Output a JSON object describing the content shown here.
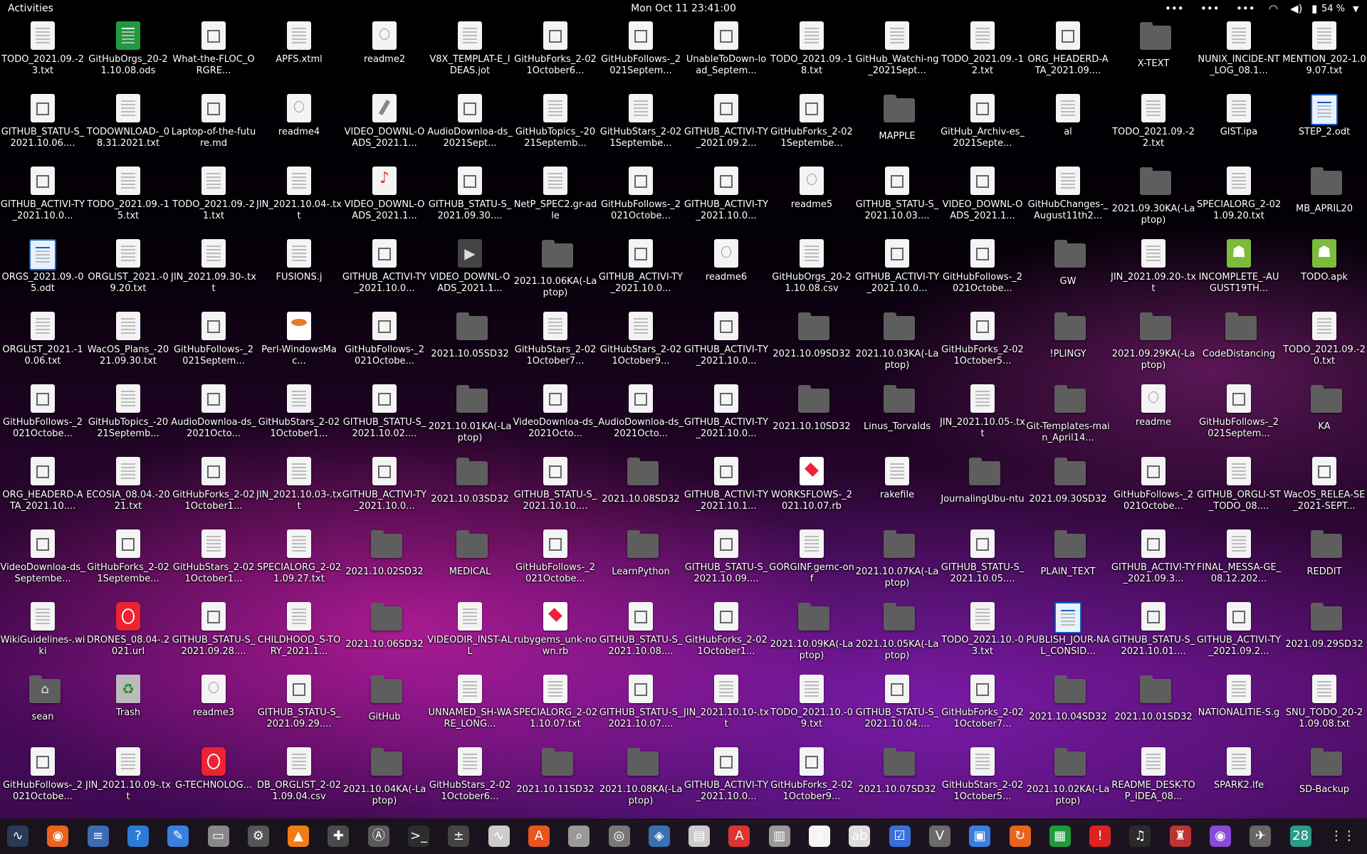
{
  "topbar": {
    "activities": "Activities",
    "clock": "Mon Oct 11  23:41:00",
    "battery": "54 %"
  },
  "desktop": {
    "icons": [
      {
        "label": "TODO_2021.09.-23.txt",
        "type": "doc"
      },
      {
        "label": "GitHubOrgs_20-21.10.08.ods",
        "type": "green"
      },
      {
        "label": "What-the-FLOC_ORGRE...",
        "type": "md"
      },
      {
        "label": "APFS.xtml",
        "type": "doc"
      },
      {
        "label": "readme2",
        "type": "info"
      },
      {
        "label": "V8X_TEMPLAT-E_IDEAS.jot",
        "type": "doc"
      },
      {
        "label": "GitHubForks_2-021October6...",
        "type": "md"
      },
      {
        "label": "GitHubFollows-_2021Septem...",
        "type": "md"
      },
      {
        "label": "UnableToDown-load_Septem...",
        "type": "md"
      },
      {
        "label": "TODO_2021.09.-18.txt",
        "type": "doc"
      },
      {
        "label": "GitHub_Watchi-ng_2021Sept...",
        "type": "doc"
      },
      {
        "label": "TODO_2021.09.-12.txt",
        "type": "doc"
      },
      {
        "label": "ORG_HEADERD-ATA_2021.09....",
        "type": "md"
      },
      {
        "label": "X-TEXT",
        "type": "folder"
      },
      {
        "label": "NUNIX_INCIDE-NT_LOG_08.1...",
        "type": "doc"
      },
      {
        "label": "MENTION_202-1.09.07.txt",
        "type": "doc"
      },
      {
        "label": "GITHUB_STATU-S_2021.10.06....",
        "type": "md"
      },
      {
        "label": "TODOWNLOAD-_08.31.2021.txt",
        "type": "doc"
      },
      {
        "label": "Laptop-of-the-future.md",
        "type": "md"
      },
      {
        "label": "readme4",
        "type": "info"
      },
      {
        "label": "VIDEO_DOWNL-OADS_2021.1...",
        "type": "hammer"
      },
      {
        "label": "AudioDownloa-ds_2021Sept...",
        "type": "md"
      },
      {
        "label": "GitHubTopics_-2021Septemb...",
        "type": "doc"
      },
      {
        "label": "GitHubStars_2-021Septembe...",
        "type": "doc"
      },
      {
        "label": "GITHUB_ACTIVI-TY_2021.09.2...",
        "type": "md"
      },
      {
        "label": "GitHubForks_2-021Septembe...",
        "type": "md"
      },
      {
        "label": "MAPPLE",
        "type": "folder"
      },
      {
        "label": "GitHub_Archiv-es_2021Septe...",
        "type": "md"
      },
      {
        "label": "al",
        "type": "doc"
      },
      {
        "label": "TODO_2021.09.-22.txt",
        "type": "doc"
      },
      {
        "label": "GIST.ipa",
        "type": "doc"
      },
      {
        "label": "STEP_2.odt",
        "type": "blue"
      },
      {
        "label": "GITHUB_ACTIVI-TY_2021.10.0...",
        "type": "md"
      },
      {
        "label": "TODO_2021.09.-15.txt",
        "type": "doc"
      },
      {
        "label": "TODO_2021.09.-21.txt",
        "type": "doc"
      },
      {
        "label": "JIN_2021.10.04-.txt",
        "type": "doc"
      },
      {
        "label": "VIDEO_DOWNL-OADS_2021.1...",
        "type": "mp3"
      },
      {
        "label": "GITHUB_STATU-S_2021.09.30....",
        "type": "md"
      },
      {
        "label": "NetP_SPEC2.gr-adle",
        "type": "doc"
      },
      {
        "label": "GitHubFollows-_2021Octobe...",
        "type": "md"
      },
      {
        "label": "GITHUB_ACTIVI-TY_2021.10.0...",
        "type": "md"
      },
      {
        "label": "readme5",
        "type": "info"
      },
      {
        "label": "GITHUB_STATU-S_2021.10.03....",
        "type": "md"
      },
      {
        "label": "VIDEO_DOWNL-OADS_2021.1...",
        "type": "md"
      },
      {
        "label": "GitHubChanges-_August11th2...",
        "type": "doc"
      },
      {
        "label": "2021.09.30KA(-Laptop)",
        "type": "folder"
      },
      {
        "label": "SPECIALORG_2-021.09.20.txt",
        "type": "doc"
      },
      {
        "label": "MB_APRIL20",
        "type": "folder"
      },
      {
        "label": "ORGS_2021.09.-05.odt",
        "type": "blue"
      },
      {
        "label": "ORGLIST_2021.-09.20.txt",
        "type": "doc"
      },
      {
        "label": "JIN_2021.09.30-.txt",
        "type": "doc"
      },
      {
        "label": "FUSIONS.j",
        "type": "doc"
      },
      {
        "label": "GITHUB_ACTIVI-TY_2021.10.0...",
        "type": "md"
      },
      {
        "label": "VIDEO_DOWNL-OADS_2021.1...",
        "type": "video"
      },
      {
        "label": "2021.10.06KA(-Laptop)",
        "type": "folder"
      },
      {
        "label": "GITHUB_ACTIVI-TY_2021.10.0...",
        "type": "md"
      },
      {
        "label": "readme6",
        "type": "info"
      },
      {
        "label": "GitHubOrgs_20-21.10.08.csv",
        "type": "doc"
      },
      {
        "label": "GITHUB_ACTIVI-TY_2021.10.0...",
        "type": "md"
      },
      {
        "label": "GitHubFollows-_2021Octobe...",
        "type": "md"
      },
      {
        "label": "GW",
        "type": "folder"
      },
      {
        "label": "JIN_2021.09.20-.txt",
        "type": "doc"
      },
      {
        "label": "INCOMPLETE_-AUGUST19TH...",
        "type": "apk"
      },
      {
        "label": "TODO.apk",
        "type": "apk"
      },
      {
        "label": "ORGLIST_2021.-10.06.txt",
        "type": "doc"
      },
      {
        "label": "WacOS_Plans_-2021.09.30.txt",
        "type": "doc"
      },
      {
        "label": "GitHubFollows-_2021Septem...",
        "type": "md"
      },
      {
        "label": "Perl-WindowsMac...",
        "type": "yaml"
      },
      {
        "label": "GitHubFollows-_2021Octobe...",
        "type": "md"
      },
      {
        "label": "2021.10.05SD32",
        "type": "folder"
      },
      {
        "label": "GitHubStars_2-021October7...",
        "type": "doc"
      },
      {
        "label": "GitHubStars_2-021October9...",
        "type": "doc"
      },
      {
        "label": "GITHUB_ACTIVI-TY_2021.10.0...",
        "type": "md"
      },
      {
        "label": "2021.10.09SD32",
        "type": "folder"
      },
      {
        "label": "2021.10.03KA(-Laptop)",
        "type": "folder"
      },
      {
        "label": "GitHubForks_2-021October5...",
        "type": "md"
      },
      {
        "label": "!PLINGY",
        "type": "folder"
      },
      {
        "label": "2021.09.29KA(-Laptop)",
        "type": "folder"
      },
      {
        "label": "CodeDistancing",
        "type": "folder"
      },
      {
        "label": "TODO_2021.09.-20.txt",
        "type": "doc"
      },
      {
        "label": "GitHubFollows-_2021Octobe...",
        "type": "md"
      },
      {
        "label": "GitHubTopics_-2021Septemb...",
        "type": "doc"
      },
      {
        "label": "AudioDownloa-ds_2021Octo...",
        "type": "md"
      },
      {
        "label": "GitHubStars_2-021October1...",
        "type": "doc"
      },
      {
        "label": "GITHUB_STATU-S_2021.10.02....",
        "type": "md"
      },
      {
        "label": "2021.10.01KA(-Laptop)",
        "type": "folder"
      },
      {
        "label": "VideoDownloa-ds_2021Octo...",
        "type": "md"
      },
      {
        "label": "AudioDownloa-ds_2021Octo...",
        "type": "md"
      },
      {
        "label": "GITHUB_ACTIVI-TY_2021.10.0...",
        "type": "md"
      },
      {
        "label": "2021.10.10SD32",
        "type": "folder"
      },
      {
        "label": "Linus_Torvalds",
        "type": "folder"
      },
      {
        "label": "JIN_2021.10.05-.txt",
        "type": "doc"
      },
      {
        "label": "Git-Templates-main_April14...",
        "type": "folder"
      },
      {
        "label": "readme",
        "type": "info"
      },
      {
        "label": "GitHubFollows-_2021Septem...",
        "type": "md"
      },
      {
        "label": "KA",
        "type": "folder"
      },
      {
        "label": "ORG_HEADERD-ATA_2021.10....",
        "type": "md"
      },
      {
        "label": "ECOSIA_08.04.-2021.txt",
        "type": "doc"
      },
      {
        "label": "GitHubForks_2-021October1...",
        "type": "md"
      },
      {
        "label": "JIN_2021.10.03-.txt",
        "type": "doc"
      },
      {
        "label": "GITHUB_ACTIVI-TY_2021.10.0...",
        "type": "md"
      },
      {
        "label": "2021.10.03SD32",
        "type": "folder"
      },
      {
        "label": "GITHUB_STATU-S_2021.10.10....",
        "type": "md"
      },
      {
        "label": "2021.10.08SD32",
        "type": "folder"
      },
      {
        "label": "GITHUB_ACTIVI-TY_2021.10.1...",
        "type": "md"
      },
      {
        "label": "WORKSFLOWS-_2021.10.07.rb",
        "type": "red"
      },
      {
        "label": "rakefile",
        "type": "doc"
      },
      {
        "label": "JournalingUbu-ntu",
        "type": "folder"
      },
      {
        "label": "2021.09.30SD32",
        "type": "folder"
      },
      {
        "label": "GitHubFollows-_2021Octobe...",
        "type": "md"
      },
      {
        "label": "GITHUB_ORGLI-ST_TODO_08....",
        "type": "doc"
      },
      {
        "label": "WacOS_RELEA-SE_2021-SEPT...",
        "type": "md"
      },
      {
        "label": "VideoDownloa-ds_Septembe...",
        "type": "md"
      },
      {
        "label": "GitHubForks_2-021Septembe...",
        "type": "md"
      },
      {
        "label": "GitHubStars_2-021October1...",
        "type": "doc"
      },
      {
        "label": "SPECIALORG_2-021.09.27.txt",
        "type": "doc"
      },
      {
        "label": "2021.10.02SD32",
        "type": "folder"
      },
      {
        "label": "MEDICAL",
        "type": "folder"
      },
      {
        "label": "GitHubFollows-_2021Octobe...",
        "type": "md"
      },
      {
        "label": "LearnPython",
        "type": "folder"
      },
      {
        "label": "GITHUB_STATU-S_2021.10.09....",
        "type": "md"
      },
      {
        "label": "GORGINF.gemc-onf",
        "type": "doc"
      },
      {
        "label": "2021.10.07KA(-Laptop)",
        "type": "folder"
      },
      {
        "label": "GITHUB_STATU-S_2021.10.05....",
        "type": "md"
      },
      {
        "label": "PLAIN_TEXT",
        "type": "folder"
      },
      {
        "label": "GITHUB_ACTIVI-TY_2021.09.3...",
        "type": "md"
      },
      {
        "label": "FINAL_MESSA-GE_08.12.202...",
        "type": "doc"
      },
      {
        "label": "REDDIT",
        "type": "folder"
      },
      {
        "label": "WikiGuidelines-.wiki",
        "type": "doc"
      },
      {
        "label": "DRONES_08.04-.2021.url",
        "type": "nosign"
      },
      {
        "label": "GITHUB_STATU-S_2021.09.28....",
        "type": "md"
      },
      {
        "label": "CHILDHOOD_S-TORY_2021.1...",
        "type": "doc"
      },
      {
        "label": "2021.10.06SD32",
        "type": "folder"
      },
      {
        "label": "VIDEODIR_INST-ALL",
        "type": "doc"
      },
      {
        "label": "rubygems_unk-nown.rb",
        "type": "red"
      },
      {
        "label": "GITHUB_STATU-S_2021.10.08....",
        "type": "md"
      },
      {
        "label": "GitHubForks_2-021October1...",
        "type": "md"
      },
      {
        "label": "2021.10.09KA(-Laptop)",
        "type": "folder"
      },
      {
        "label": "2021.10.05KA(-Laptop)",
        "type": "folder"
      },
      {
        "label": "TODO_2021.10.-03.txt",
        "type": "doc"
      },
      {
        "label": "PUBLISH_JOUR-NAL_CONSID...",
        "type": "blue"
      },
      {
        "label": "GITHUB_STATU-S_2021.10.01....",
        "type": "md"
      },
      {
        "label": "GITHUB_ACTIVI-TY_2021.09.2...",
        "type": "md"
      },
      {
        "label": "2021.09.29SD32",
        "type": "folder"
      },
      {
        "label": "sean",
        "type": "home"
      },
      {
        "label": "Trash",
        "type": "trash"
      },
      {
        "label": "readme3",
        "type": "info"
      },
      {
        "label": "GITHUB_STATU-S_2021.09.29....",
        "type": "md"
      },
      {
        "label": "GitHub",
        "type": "folder"
      },
      {
        "label": "UNNAMED_SH-WARE_LONG...",
        "type": "doc"
      },
      {
        "label": "SPECIALORG_2-021.10.07.txt",
        "type": "doc"
      },
      {
        "label": "GITHUB_STATU-S_2021.10.07....",
        "type": "md"
      },
      {
        "label": "JIN_2021.10.10-.txt",
        "type": "doc"
      },
      {
        "label": "TODO_2021.10.-09.txt",
        "type": "doc"
      },
      {
        "label": "GITHUB_STATU-S_2021.10.04....",
        "type": "md"
      },
      {
        "label": "GitHubForks_2-021October7...",
        "type": "md"
      },
      {
        "label": "2021.10.04SD32",
        "type": "folder"
      },
      {
        "label": "2021.10.01SD32",
        "type": "folder"
      },
      {
        "label": "NATIONALITIE-S.g",
        "type": "doc"
      },
      {
        "label": "SNU_TODO_20-21.09.08.txt",
        "type": "doc"
      },
      {
        "label": "GitHubFollows-_2021Octobe...",
        "type": "md"
      },
      {
        "label": "JIN_2021.10.09-.txt",
        "type": "doc"
      },
      {
        "label": "G-TECHNOLOG...",
        "type": "nosign"
      },
      {
        "label": "DB_ORGLIST_2-021.09.04.csv",
        "type": "doc"
      },
      {
        "label": "2021.10.04KA(-Laptop)",
        "type": "folder"
      },
      {
        "label": "GitHubStars_2-021October6...",
        "type": "doc"
      },
      {
        "label": "2021.10.11SD32",
        "type": "folder"
      },
      {
        "label": "2021.10.08KA(-Laptop)",
        "type": "folder"
      },
      {
        "label": "GITHUB_ACTIVI-TY_2021.10.0...",
        "type": "md"
      },
      {
        "label": "GitHubForks_2-021October9...",
        "type": "md"
      },
      {
        "label": "2021.10.07SD32",
        "type": "folder"
      },
      {
        "label": "GitHubStars_2-021October5...",
        "type": "doc"
      },
      {
        "label": "2021.10.02KA(-Laptop)",
        "type": "folder"
      },
      {
        "label": "README_DESK-TOP_IDEA_08...",
        "type": "doc"
      },
      {
        "label": "SPARK2.lfe",
        "type": "doc"
      },
      {
        "label": "SD-Backup",
        "type": "folder"
      }
    ]
  },
  "dock": {
    "items": [
      {
        "name": "system-monitor-icon",
        "glyph": "∿",
        "color": "#2b3a55"
      },
      {
        "name": "firefox-icon",
        "glyph": "◉",
        "color": "#e8641f"
      },
      {
        "name": "text-editor-icon",
        "glyph": "≡",
        "color": "#3d6bb3"
      },
      {
        "name": "help-icon",
        "glyph": "?",
        "color": "#2a7bd8"
      },
      {
        "name": "notes-icon",
        "glyph": "✎",
        "color": "#3a7fe0"
      },
      {
        "name": "files-icon",
        "glyph": "▭",
        "color": "#888"
      },
      {
        "name": "settings-icon",
        "glyph": "⚙",
        "color": "#555"
      },
      {
        "name": "vlc-icon",
        "glyph": "▲",
        "color": "#f07d14"
      },
      {
        "name": "extensions-icon",
        "glyph": "✚",
        "color": "#4a4a4a"
      },
      {
        "name": "software-updater-icon",
        "glyph": "Ⓐ",
        "color": "#5a5a5a"
      },
      {
        "name": "terminal-icon",
        "glyph": ">_",
        "color": "#2d2d2d"
      },
      {
        "name": "calculator-icon",
        "glyph": "±",
        "color": "#444"
      },
      {
        "name": "activity-monitor-icon",
        "glyph": "∿",
        "color": "#ccc"
      },
      {
        "name": "app-store-icon",
        "glyph": "A",
        "color": "#e95420"
      },
      {
        "name": "search-icon",
        "glyph": "⌕",
        "color": "#999"
      },
      {
        "name": "disk-icon",
        "glyph": "◎",
        "color": "#777"
      },
      {
        "name": "image-viewer-icon",
        "glyph": "◈",
        "color": "#3a6fb0"
      },
      {
        "name": "reader-icon",
        "glyph": "▤",
        "color": "#ccc"
      },
      {
        "name": "font-viewer-icon",
        "glyph": "A",
        "color": "#d33"
      },
      {
        "name": "archive-icon",
        "glyph": "▥",
        "color": "#999"
      },
      {
        "name": "characters-icon",
        "glyph": "à",
        "color": "#f4f4f4"
      },
      {
        "name": "dictionary-icon",
        "glyph": "ab",
        "color": "#ddd"
      },
      {
        "name": "tasks-icon",
        "glyph": "☑",
        "color": "#3a6fd8"
      },
      {
        "name": "vim-icon",
        "glyph": "V",
        "color": "#6a6a6a"
      },
      {
        "name": "screen-icon",
        "glyph": "▣",
        "color": "#3a7fe0"
      },
      {
        "name": "backup-icon",
        "glyph": "↻",
        "color": "#e8641f"
      },
      {
        "name": "spreadsheet-icon",
        "glyph": "▦",
        "color": "#1f9a3c"
      },
      {
        "name": "alert-icon",
        "glyph": "!",
        "color": "#d22"
      },
      {
        "name": "music-icon",
        "glyph": "♫",
        "color": "#2b2b2b"
      },
      {
        "name": "game-icon",
        "glyph": "♜",
        "color": "#b33"
      },
      {
        "name": "camera-icon",
        "glyph": "◉",
        "color": "#8a4ad8"
      },
      {
        "name": "tweaks-icon",
        "glyph": "✈",
        "color": "#666"
      },
      {
        "name": "calendar-icon",
        "glyph": "28",
        "color": "#2a9a8a"
      },
      {
        "name": "show-apps-icon",
        "glyph": "⋮⋮",
        "color": "transparent"
      }
    ]
  }
}
